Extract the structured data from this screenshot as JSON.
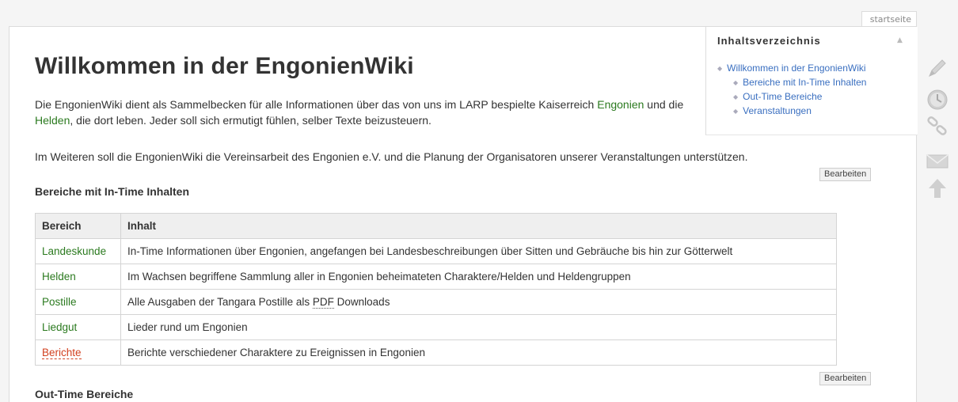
{
  "tab": {
    "label": "startseite"
  },
  "page": {
    "title": "Willkommen in der EngonienWiki",
    "intro": {
      "part1": "Die EngonienWiki dient als Sammelbecken für alle Informationen über das von uns im LARP bespielte Kaiserreich ",
      "link_engonien": "Engonien",
      "part2": " und die ",
      "link_helden": "Helden",
      "part3": ", die dort leben. Jeder soll sich ermutigt fühlen, selber Texte beizusteuern."
    },
    "intro2": "Im Weiteren soll die EngonienWiki die Vereinsarbeit des Engonien e.V. und die Planung der Organisatoren unserer Veranstaltungen unterstützen.",
    "edit_label": "Bearbeiten",
    "section1_title": "Bereiche mit In-Time Inhalten",
    "section2_title": "Out-Time Bereiche"
  },
  "toc": {
    "title": "Inhaltsverzeichnis",
    "toggle": "▲",
    "items": [
      {
        "label": "Willkommen in der EngonienWiki"
      },
      {
        "label": "Bereiche mit In-Time Inhalten"
      },
      {
        "label": "Out-Time Bereiche"
      },
      {
        "label": "Veranstaltungen"
      }
    ]
  },
  "table": {
    "headers": [
      "Bereich",
      "Inhalt"
    ],
    "rows": [
      {
        "area": "Landeskunde",
        "content": "In-Time Informationen über Engonien, angefangen bei Landesbeschreibungen über Sitten und Gebräuche bis hin zur Götterwelt"
      },
      {
        "area": "Helden",
        "content": "Im Wachsen begriffene Sammlung aller in Engonien beheimateten Charaktere/Helden und Heldengruppen"
      },
      {
        "area": "Postille",
        "content_pre": "Alle Ausgaben der Tangara Postille als ",
        "content_abbr": "PDF",
        "content_post": " Downloads"
      },
      {
        "area": "Liedgut",
        "content": "Lieder rund um Engonien"
      },
      {
        "area": "Berichte",
        "content": "Berichte verschiedener Charaktere zu Ereignissen in Engonien"
      }
    ]
  },
  "sidebar": {
    "icons": [
      "pencil-icon",
      "clock-icon",
      "link-icon",
      "mail-icon",
      "arrow-up-icon"
    ]
  },
  "colors": {
    "wikilink": "#2b7a1f",
    "redlink": "#d2401f",
    "toclink": "#3a6fc0"
  }
}
